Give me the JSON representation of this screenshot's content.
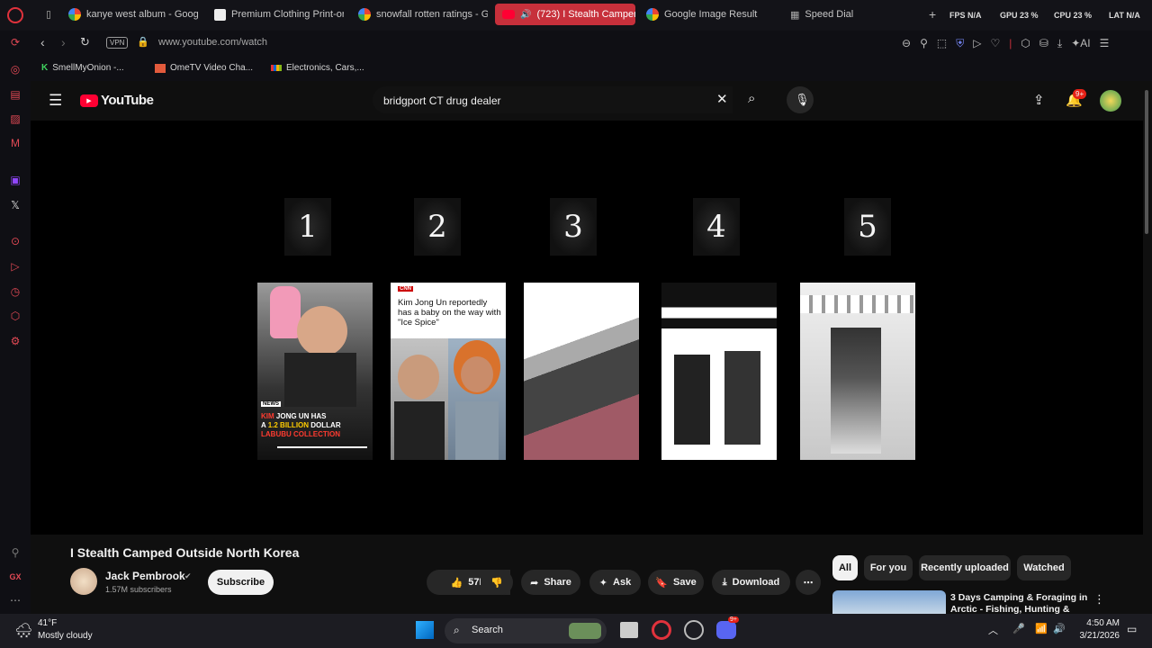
{
  "tabs": [
    {
      "label": "kanye west album - Googl"
    },
    {
      "label": "Premium Clothing Print-on"
    },
    {
      "label": "snowfall rotten ratings - G"
    },
    {
      "label": "(723) I Stealth Camper"
    },
    {
      "label": "Google Image Result"
    },
    {
      "label": "Speed Dial"
    }
  ],
  "stats": {
    "fps_label": "FPS",
    "fps_val": "N/A",
    "gpu_label": "GPU",
    "gpu_val": "23 %",
    "cpu_label": "CPU",
    "cpu_val": "23 %",
    "lat_label": "LAT",
    "lat_val": "N/A"
  },
  "address": {
    "vpn": "VPN",
    "url": "www.youtube.com/watch"
  },
  "bookmarks": [
    {
      "label": "SmellMyOnion -..."
    },
    {
      "label": "OmeTV Video Cha..."
    },
    {
      "label": "Electronics, Cars,..."
    }
  ],
  "yt": {
    "logo": "YouTube",
    "search_value": "bridgport CT drug dealer",
    "notif_badge": "9+",
    "numbers": [
      "1",
      "2",
      "3",
      "4",
      "5"
    ],
    "thumb1": {
      "badge": "NEWS",
      "line1_a": "KIM ",
      "line1_b": "JONG UN HAS",
      "line2_a": "A ",
      "line2_b": "1.2 BILLION",
      "line2_c": " DOLLAR",
      "line3": "LABUBU COLLECTION"
    },
    "thumb2": {
      "brand": "CNN",
      "headline": "Kim Jong Un reportedly has a baby on the way with \"Ice Spice\""
    },
    "video_title": "I Stealth Camped Outside North Korea",
    "channel": "Jack Pembrook",
    "subs": "1.57M subscribers",
    "subscribe": "Subscribe",
    "likes": "57K",
    "share": "Share",
    "ask": "Ask",
    "save": "Save",
    "download": "Download",
    "chips": [
      "All",
      "For you",
      "Recently uploaded",
      "Watched"
    ],
    "rec_title": "3 Days Camping & Foraging in Arctic - Fishing, Hunting &"
  },
  "taskbar": {
    "temp": "41°F",
    "weather": "Mostly cloudy",
    "search": "Search",
    "time": "4:50 AM",
    "date": "3/21/2026",
    "discord_badge": "9+"
  },
  "colors": {
    "accent": "#c7303b",
    "yt_red": "#ff0033"
  }
}
